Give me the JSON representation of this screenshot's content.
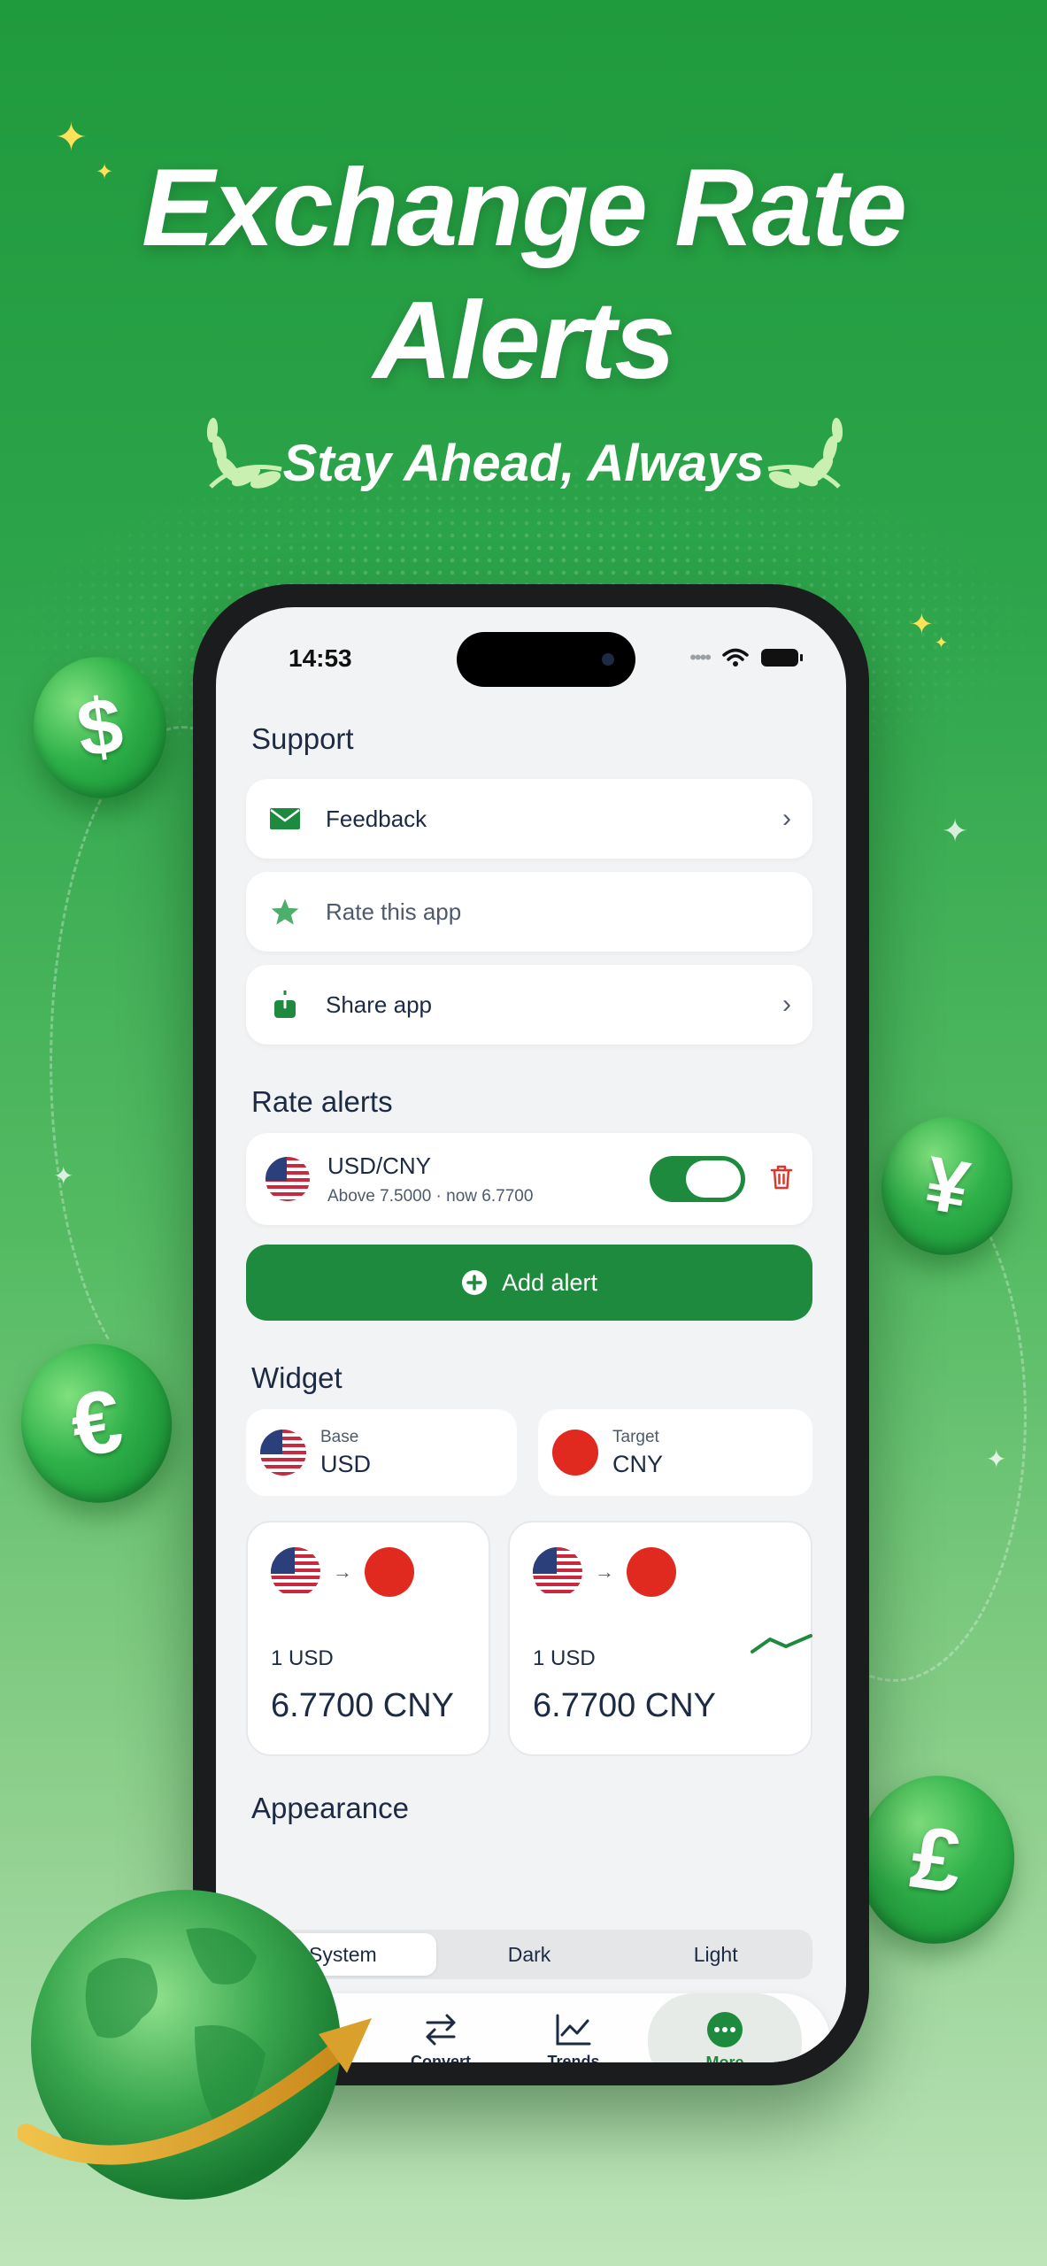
{
  "promo": {
    "headline_line1": "Exchange Rate",
    "headline_line2": "Alerts",
    "tagline": "Stay Ahead, Always"
  },
  "coins": {
    "dollar": "$",
    "yen": "¥",
    "euro": "€",
    "pound": "£"
  },
  "status_bar": {
    "time": "14:53"
  },
  "support": {
    "title": "Support",
    "items": [
      {
        "label": "Feedback",
        "icon": "envelope-icon"
      },
      {
        "label": "Rate this app",
        "icon": "star-icon"
      },
      {
        "label": "Share app",
        "icon": "share-icon"
      }
    ]
  },
  "rate_alerts": {
    "title": "Rate alerts",
    "alert": {
      "pair": "USD/CNY",
      "detail": "Above 7.5000 · now 6.7700",
      "enabled": true
    },
    "add_button": "Add alert"
  },
  "widget": {
    "title": "Widget",
    "base": {
      "label": "Base",
      "value": "USD"
    },
    "target": {
      "label": "Target",
      "value": "CNY"
    },
    "previews": [
      {
        "amount": "1  USD",
        "result": "6.7700 CNY"
      },
      {
        "amount": "1  USD",
        "result": "6.7700 CNY"
      }
    ]
  },
  "appearance": {
    "title": "Appearance",
    "options": [
      "System",
      "Dark",
      "Light"
    ],
    "selected": "System"
  },
  "tabbar": {
    "tabs": [
      {
        "label": "Convert",
        "icon": "convert-arrows-icon"
      },
      {
        "label": "Trends",
        "icon": "chart-icon"
      },
      {
        "label": "More",
        "icon": "more-icon",
        "active": true
      }
    ]
  },
  "colors": {
    "brand_green": "#1e8a3e",
    "text_dark": "#1c2a44",
    "delete_red": "#e0352b"
  }
}
